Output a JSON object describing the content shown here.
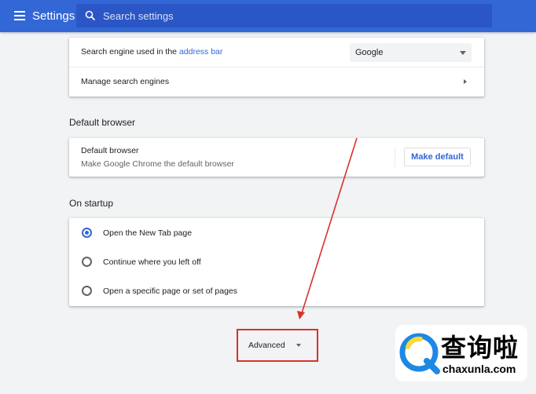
{
  "header": {
    "title": "Settings",
    "search_placeholder": "Search settings"
  },
  "search_engine": {
    "label_prefix": "Search engine used in the",
    "label_link": "address bar",
    "selected_engine": "Google",
    "manage_label": "Manage search engines"
  },
  "default_browser": {
    "section_title": "Default browser",
    "row_title": "Default browser",
    "row_subtitle": "Make Google Chrome the default browser",
    "button_label": "Make default"
  },
  "on_startup": {
    "section_title": "On startup",
    "options": [
      {
        "label": "Open the New Tab page",
        "selected": true
      },
      {
        "label": "Continue where you left off",
        "selected": false
      },
      {
        "label": "Open a specific page or set of pages",
        "selected": false
      }
    ]
  },
  "advanced": {
    "label": "Advanced"
  },
  "watermark": {
    "brand_cn": "查询啦",
    "brand_en": "chaxunla.com"
  },
  "colors": {
    "header": "#3367d6",
    "accent": "#3367d6",
    "highlight_box": "#d8312d"
  },
  "icons": [
    "menu-icon",
    "search-icon",
    "dropdown-caret-icon",
    "chevron-right-icon",
    "radio-icon",
    "annotation-arrow",
    "watermark-logo-icon"
  ]
}
